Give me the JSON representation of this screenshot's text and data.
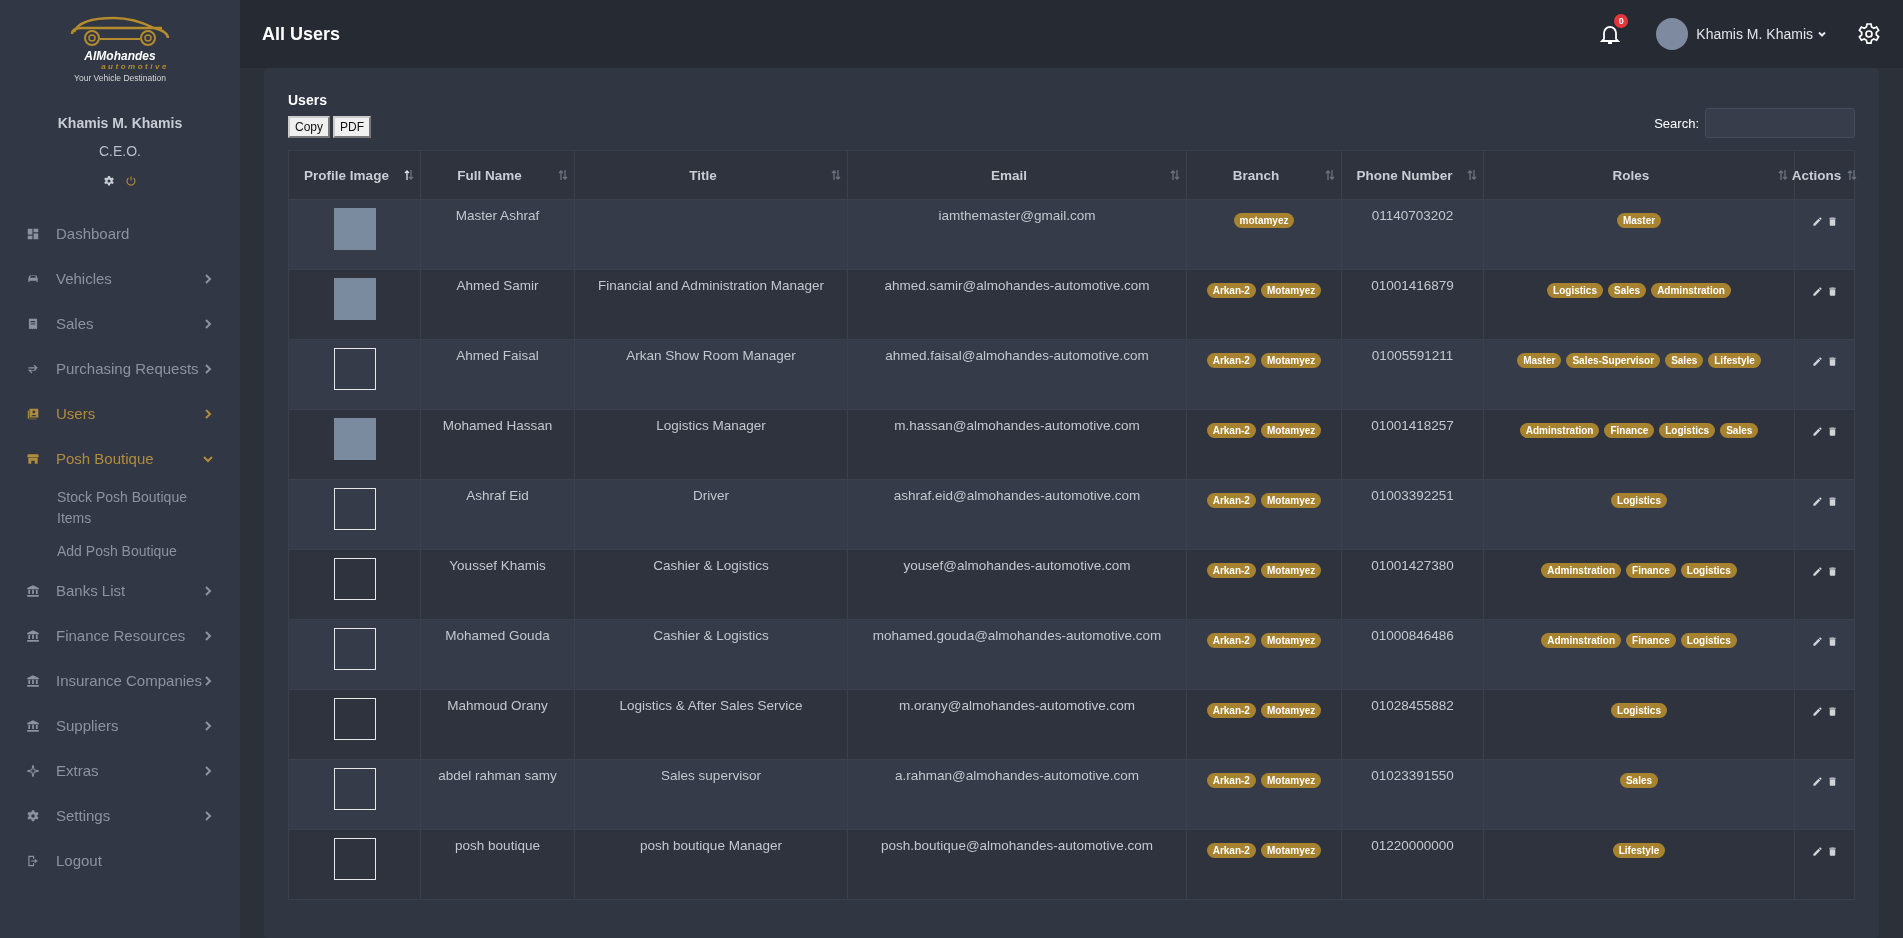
{
  "brand": {
    "name": "AlMohandes",
    "subname": "automotive",
    "tagline": "Your Vehicle Destination"
  },
  "profile": {
    "name": "Khamis M. Khamis",
    "role": "C.E.O."
  },
  "sidebar": {
    "items": [
      {
        "label": "Dashboard",
        "expandable": false,
        "selected": false
      },
      {
        "label": "Vehicles",
        "expandable": true,
        "selected": false,
        "expanded": false
      },
      {
        "label": "Sales",
        "expandable": true,
        "selected": false,
        "expanded": false
      },
      {
        "label": "Purchasing Requests",
        "expandable": true,
        "selected": false,
        "expanded": false
      },
      {
        "label": "Users",
        "expandable": true,
        "selected": true,
        "expanded": false
      },
      {
        "label": "Posh Boutique",
        "expandable": true,
        "selected": true,
        "expanded": true,
        "children": [
          {
            "label": "Stock Posh Boutique Items"
          },
          {
            "label": "Add Posh Boutique"
          }
        ]
      },
      {
        "label": "Banks List",
        "expandable": true,
        "selected": false,
        "expanded": false
      },
      {
        "label": "Finance Resources",
        "expandable": true,
        "selected": false,
        "expanded": false
      },
      {
        "label": "Insurance Companies",
        "expandable": true,
        "selected": false,
        "expanded": false
      },
      {
        "label": "Suppliers",
        "expandable": true,
        "selected": false,
        "expanded": false
      },
      {
        "label": "Extras",
        "expandable": true,
        "selected": false,
        "expanded": false
      },
      {
        "label": "Settings",
        "expandable": true,
        "selected": false,
        "expanded": false
      },
      {
        "label": "Logout",
        "expandable": false,
        "selected": false
      }
    ]
  },
  "header": {
    "title": "All Users",
    "notifications": "0",
    "user": "Khamis M. Khamis"
  },
  "card": {
    "title": "Users",
    "buttons": [
      "Copy",
      "PDF"
    ],
    "search_label": "Search:"
  },
  "table": {
    "columns": [
      {
        "label": "Profile Image",
        "sorted": true
      },
      {
        "label": "Full Name",
        "sorted": false
      },
      {
        "label": "Title",
        "sorted": false
      },
      {
        "label": "Email",
        "sorted": false
      },
      {
        "label": "Branch",
        "sorted": false
      },
      {
        "label": "Phone Number",
        "sorted": false
      },
      {
        "label": "Roles",
        "sorted": false
      },
      {
        "label": "Actions",
        "sorted": false
      }
    ],
    "rows": [
      {
        "has_photo": true,
        "name": "Master Ashraf",
        "title": "",
        "email": "iamthemaster@gmail.com",
        "branches": [
          "motamyez"
        ],
        "phone": "01140703202",
        "roles": [
          "Master"
        ]
      },
      {
        "has_photo": true,
        "name": "Ahmed Samir",
        "title": "Financial and Administration Manager",
        "email": "ahmed.samir@almohandes-automotive.com",
        "branches": [
          "Arkan-2",
          "Motamyez"
        ],
        "phone": "01001416879",
        "roles": [
          "Logistics",
          "Sales",
          "Adminstration"
        ]
      },
      {
        "has_photo": false,
        "name": "Ahmed Faisal",
        "title": "Arkan Show Room Manager",
        "email": "ahmed.faisal@almohandes-automotive.com",
        "branches": [
          "Arkan-2",
          "Motamyez"
        ],
        "phone": "01005591211",
        "roles": [
          "Master",
          "Sales-Supervisor",
          "Sales",
          "Lifestyle"
        ]
      },
      {
        "has_photo": true,
        "name": "Mohamed Hassan",
        "title": "Logistics Manager",
        "email": "m.hassan@almohandes-automotive.com",
        "branches": [
          "Arkan-2",
          "Motamyez"
        ],
        "phone": "01001418257",
        "roles": [
          "Adminstration",
          "Finance",
          "Logistics",
          "Sales"
        ]
      },
      {
        "has_photo": false,
        "name": "Ashraf Eid",
        "title": "Driver",
        "email": "ashraf.eid@almohandes-automotive.com",
        "branches": [
          "Arkan-2",
          "Motamyez"
        ],
        "phone": "01003392251",
        "roles": [
          "Logistics"
        ]
      },
      {
        "has_photo": false,
        "name": "Youssef Khamis",
        "title": "Cashier & Logistics",
        "email": "yousef@almohandes-automotive.com",
        "branches": [
          "Arkan-2",
          "Motamyez"
        ],
        "phone": "01001427380",
        "roles": [
          "Adminstration",
          "Finance",
          "Logistics"
        ]
      },
      {
        "has_photo": false,
        "name": "Mohamed Gouda",
        "title": "Cashier & Logistics",
        "email": "mohamed.gouda@almohandes-automotive.com",
        "branches": [
          "Arkan-2",
          "Motamyez"
        ],
        "phone": "01000846486",
        "roles": [
          "Adminstration",
          "Finance",
          "Logistics"
        ]
      },
      {
        "has_photo": false,
        "name": "Mahmoud Orany",
        "title": "Logistics & After Sales Service",
        "email": "m.orany@almohandes-automotive.com",
        "branches": [
          "Arkan-2",
          "Motamyez"
        ],
        "phone": "01028455882",
        "roles": [
          "Logistics"
        ]
      },
      {
        "has_photo": false,
        "name": "abdel rahman samy",
        "title": "Sales supervisor",
        "email": "a.rahman@almohandes-automotive.com",
        "branches": [
          "Arkan-2",
          "Motamyez"
        ],
        "phone": "01023391550",
        "roles": [
          "Sales"
        ]
      },
      {
        "has_photo": false,
        "name": "posh boutique",
        "title": "posh boutique Manager",
        "email": "posh.boutique@almohandes-automotive.com",
        "branches": [
          "Arkan-2",
          "Motamyez"
        ],
        "phone": "01220000000",
        "roles": [
          "Lifestyle"
        ]
      }
    ]
  }
}
